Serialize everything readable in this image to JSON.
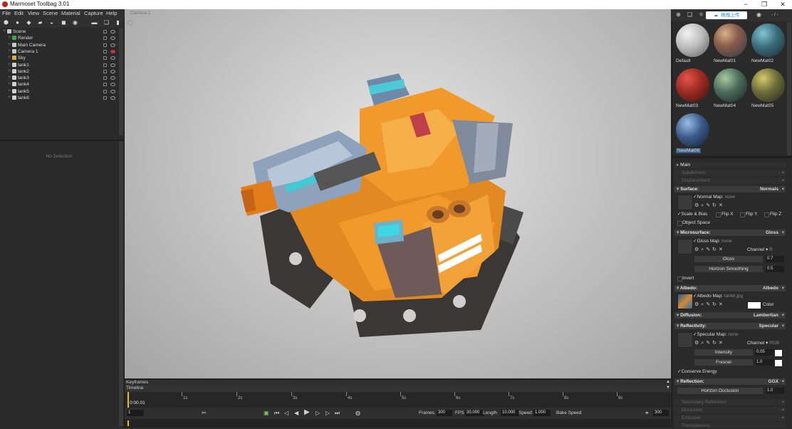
{
  "app": {
    "title": "Marmoset Toolbag 3.01",
    "window_buttons": [
      "−",
      "❐",
      "✕"
    ]
  },
  "menu": [
    "File",
    "Edit",
    "View",
    "Scene",
    "Material",
    "Capture",
    "Help"
  ],
  "scene_tree": [
    {
      "label": "Scene",
      "icon_color": "#c8c8c8",
      "level": 0
    },
    {
      "label": "Render",
      "icon_color": "#33aa44",
      "level": 1
    },
    {
      "label": "Main Camera",
      "icon_color": "#c8c8c8",
      "level": 1
    },
    {
      "label": "Camera 1",
      "icon_color": "#c8c8c8",
      "level": 1,
      "hidden": true
    },
    {
      "label": "Sky",
      "icon_color": "#d8b032",
      "level": 1
    },
    {
      "label": "tank1",
      "icon_color": "#d0d0d0",
      "level": 1
    },
    {
      "label": "tank2",
      "icon_color": "#d0d0d0",
      "level": 1
    },
    {
      "label": "tank3",
      "icon_color": "#d0d0d0",
      "level": 1
    },
    {
      "label": "tank4",
      "icon_color": "#d0d0d0",
      "level": 1
    },
    {
      "label": "tank5",
      "icon_color": "#d0d0d0",
      "level": 1
    },
    {
      "label": "tank6",
      "icon_color": "#d0d0d0",
      "level": 1
    }
  ],
  "properties": {
    "empty_label": "No Selection"
  },
  "viewport": {
    "camera_label": "Camera 1"
  },
  "timeline": {
    "keyframes_label": "Keyframes",
    "timeline_label": "Timeline",
    "current_time": "0:00.01",
    "second_marks": [
      "1s",
      "2s",
      "3s",
      "4s",
      "5s",
      "6s",
      "7s",
      "8s",
      "9s"
    ],
    "current_frame": "1",
    "frames_label": "Frames",
    "frames_value": "300",
    "fps_label": "FPS",
    "fps_value": "30.000",
    "length_label": "Length",
    "length_value": "10.000",
    "speed_label": "Speed",
    "speed_value": "1.000",
    "bake_speed_label": "Bake Speed",
    "end_frame": "300"
  },
  "right_toolbar": {
    "upload_badge": "拖拽上传",
    "page": "- / -"
  },
  "materials": [
    {
      "name": "Default",
      "color": "#c9c9c9",
      "selected": false
    },
    {
      "name": "NewMat01",
      "color": "#7a5a4a",
      "selected": false
    },
    {
      "name": "NewMat02",
      "color": "#3a6a78",
      "selected": false
    },
    {
      "name": "NewMat03",
      "color": "#9a2a22",
      "selected": false
    },
    {
      "name": "NewMat04",
      "color": "#4a6a5a",
      "selected": false
    },
    {
      "name": "NewMat05",
      "color": "#6a6a3a",
      "selected": false
    },
    {
      "name": "NewMat06",
      "color": "#3a5a8a",
      "selected": true
    }
  ],
  "material_editor": {
    "main": "Main",
    "subdivision": "Subdivision:",
    "displacement": "Displacement:",
    "surface": {
      "label": "Surface:",
      "mode": "Normals",
      "map_label": "Normal Map:",
      "map_value": "none",
      "scale_bias": "Scale & Bias",
      "flip_x": "Flip X",
      "flip_y": "Flip Y",
      "flip_z": "Flip Z",
      "object_space": "Object Space"
    },
    "microsurface": {
      "label": "Microsurface:",
      "mode": "Gloss",
      "map_label": "Gloss Map:",
      "map_value": "none",
      "channel_label": "Channel",
      "channel_value": "R",
      "gloss_label": "Gloss",
      "gloss_value": "0.7",
      "horizon_label": "Horizon Smoothing",
      "horizon_value": "0.5",
      "invert": "Invert"
    },
    "albedo": {
      "label": "Albedo:",
      "mode": "Albedo",
      "map_label": "Albedo Map:",
      "map_value": "tank6.jpg",
      "color_label": "Color"
    },
    "diffusion": {
      "label": "Diffusion:",
      "mode": "Lambertian"
    },
    "reflectivity": {
      "label": "Reflectivity:",
      "mode": "Specular",
      "map_label": "Specular Map:",
      "map_value": "none",
      "channel_label": "Channel",
      "channel_value": "RGB",
      "intensity_label": "Intensity",
      "intensity_value": "0.05",
      "fresnel_label": "Fresnel",
      "fresnel_value": "1.0",
      "conserve": "Conserve Energy"
    },
    "reflection": {
      "label": "Reflection:",
      "mode": "GGX",
      "horizon_label": "Horizon Occlusion",
      "horizon_value": "1.0"
    },
    "secondary_reflection": "Secondary Reflection:",
    "occlusion": "Occlusion:",
    "emissive": "Emissive:",
    "transparency": "Transparency:"
  }
}
